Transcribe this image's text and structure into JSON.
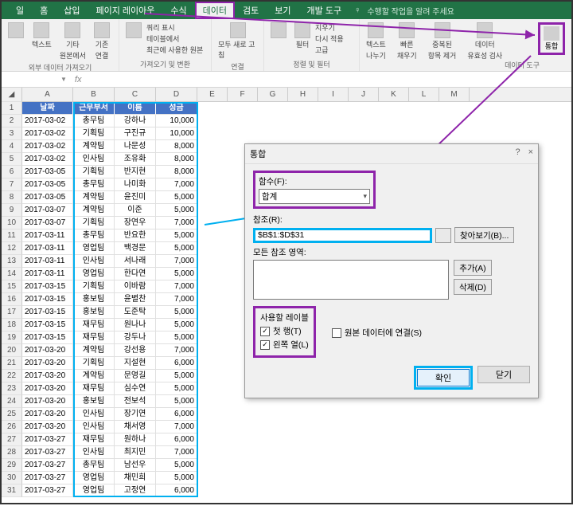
{
  "ribbon": {
    "tabs": [
      "일",
      "홈",
      "삽입",
      "페이지 레이아웃",
      "수식",
      "데이터",
      "검토",
      "보기",
      "개발 도구"
    ],
    "active_tab": "데이터",
    "tell_me": "수행할 작업을 알려 주세요",
    "groups": {
      "external": {
        "label": "외부 데이터 가져오기"
      },
      "get_transform": {
        "label": "가져오기 및 변환",
        "items": [
          "쿼리 표시",
          "테이블에서",
          "최근에 사용한 원본"
        ]
      },
      "connections": {
        "label": "연결",
        "items": [
          "모두 새로 고침"
        ]
      },
      "sort_filter": {
        "label": "정렬 및 필터",
        "items": [
          "필터",
          "정렬",
          "지우기",
          "다시 적용",
          "고급"
        ]
      },
      "data_tools": {
        "label": "데이터 도구",
        "items": [
          "텍스트 나누기",
          "빠른 채우기",
          "중복된 항목 제거",
          "데이터 유효성 검사"
        ],
        "consolidate": "통합"
      }
    }
  },
  "name_box": "",
  "columns": [
    "A",
    "B",
    "C",
    "D",
    "E",
    "F",
    "G",
    "H",
    "I",
    "J",
    "K",
    "L",
    "M"
  ],
  "table": {
    "headers": [
      "날짜",
      "근무부서",
      "이름",
      "성금"
    ],
    "rows": [
      [
        "2017-03-02",
        "총무팀",
        "강하나",
        "10,000"
      ],
      [
        "2017-03-02",
        "기획팀",
        "구진규",
        "10,000"
      ],
      [
        "2017-03-02",
        "계약팀",
        "나문성",
        "8,000"
      ],
      [
        "2017-03-02",
        "인사팀",
        "조유화",
        "8,000"
      ],
      [
        "2017-03-05",
        "기획팀",
        "반지현",
        "8,000"
      ],
      [
        "2017-03-05",
        "총무팀",
        "나미화",
        "7,000"
      ],
      [
        "2017-03-05",
        "계약팀",
        "윤진미",
        "5,000"
      ],
      [
        "2017-03-07",
        "계약팀",
        "이준",
        "5,000"
      ],
      [
        "2017-03-07",
        "기획팀",
        "장연우",
        "7,000"
      ],
      [
        "2017-03-11",
        "총무팀",
        "반요한",
        "5,000"
      ],
      [
        "2017-03-11",
        "영업팀",
        "백경문",
        "5,000"
      ],
      [
        "2017-03-11",
        "인사팀",
        "서나래",
        "7,000"
      ],
      [
        "2017-03-11",
        "영업팀",
        "한다연",
        "5,000"
      ],
      [
        "2017-03-15",
        "기획팀",
        "이바람",
        "7,000"
      ],
      [
        "2017-03-15",
        "홍보팀",
        "윤별찬",
        "7,000"
      ],
      [
        "2017-03-15",
        "홍보팀",
        "도준탁",
        "5,000"
      ],
      [
        "2017-03-15",
        "재무팀",
        "원나나",
        "5,000"
      ],
      [
        "2017-03-15",
        "재무팀",
        "강두나",
        "5,000"
      ],
      [
        "2017-03-20",
        "계약팀",
        "강선용",
        "7,000"
      ],
      [
        "2017-03-20",
        "기획팀",
        "지설현",
        "6,000"
      ],
      [
        "2017-03-20",
        "계약팀",
        "문영길",
        "5,000"
      ],
      [
        "2017-03-20",
        "재무팀",
        "심수연",
        "5,000"
      ],
      [
        "2017-03-20",
        "홍보팀",
        "전보석",
        "5,000"
      ],
      [
        "2017-03-20",
        "인사팀",
        "장기연",
        "6,000"
      ],
      [
        "2017-03-20",
        "인사팀",
        "채서영",
        "7,000"
      ],
      [
        "2017-03-27",
        "재무팀",
        "원하나",
        "6,000"
      ],
      [
        "2017-03-27",
        "인사팀",
        "최지민",
        "7,000"
      ],
      [
        "2017-03-27",
        "총무팀",
        "남선우",
        "5,000"
      ],
      [
        "2017-03-27",
        "영업팀",
        "채민희",
        "5,000"
      ],
      [
        "2017-03-27",
        "영업팀",
        "고정연",
        "6,000"
      ]
    ]
  },
  "dialog": {
    "title": "통합",
    "function_label": "함수(F):",
    "function_value": "합계",
    "reference_label": "참조(R):",
    "reference_value": "$B$1:$D$31",
    "browse": "찾아보기(B)...",
    "all_refs_label": "모든 참조 영역:",
    "add": "추가(A)",
    "delete": "삭제(D)",
    "use_labels": "사용할 레이블",
    "top_row": "첫 행(T)",
    "left_col": "왼쪽 열(L)",
    "link_source": "원본 데이터에 연결(S)",
    "ok": "확인",
    "cancel": "닫기"
  }
}
